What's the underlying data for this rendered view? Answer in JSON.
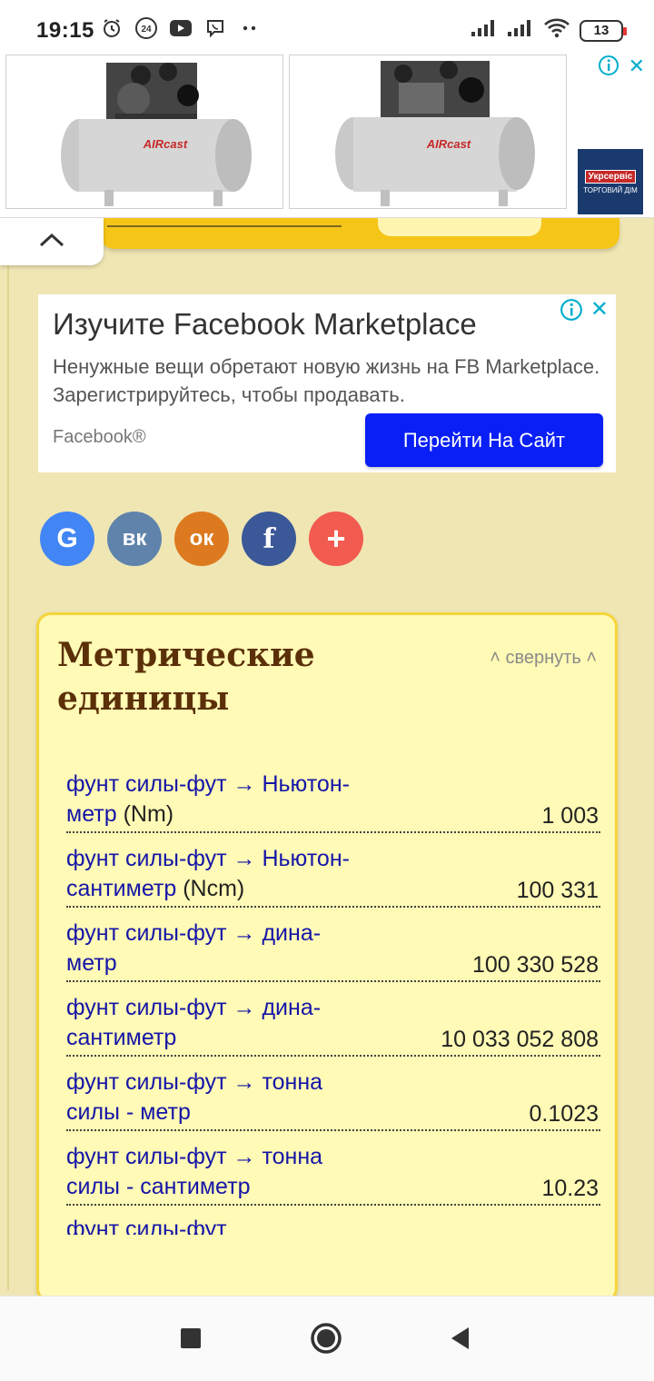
{
  "status_bar": {
    "time": "19:15",
    "notif_icons": [
      "alarm-icon",
      "clock-24-icon",
      "youtube-icon",
      "viber-icon",
      "more-dots-icon"
    ],
    "battery": "13"
  },
  "top_ad": {
    "product_brand": "AIRcast",
    "advertiser_name": "Укрсервіс",
    "advertiser_sub": "ТОРГОВИЙ ДІМ"
  },
  "fb_ad": {
    "title": "Изучите Facebook Marketplace",
    "description": "Ненужные вещи обретают новую жизнь на FB Marketplace. Зарегистрируйтесь, чтобы продавать.",
    "source": "Facebook®",
    "cta": "Перейти На Сайт"
  },
  "share": [
    {
      "name": "google",
      "glyph": "G",
      "color": "#4285f4"
    },
    {
      "name": "vk",
      "glyph": "вк",
      "color": "#5f83aa"
    },
    {
      "name": "odnoklassniki",
      "glyph": "ок",
      "color": "#dd7a1f"
    },
    {
      "name": "facebook",
      "glyph": "f",
      "color": "#3b5998"
    },
    {
      "name": "more",
      "glyph": "+",
      "color": "#f25b4f"
    }
  ],
  "units": {
    "title": "Метрические единицы",
    "collapse_label": "свернуть",
    "rows": [
      {
        "label": "фунт силы-фут → Ньютон-метр",
        "abbr": "(Nm)",
        "value": "1 003"
      },
      {
        "label": "фунт силы-фут → Ньютон-сантиметр",
        "abbr": "(Ncm)",
        "value": "100 331"
      },
      {
        "label": "фунт силы-фут → дина-метр",
        "abbr": "",
        "value": "100 330 528"
      },
      {
        "label": "фунт силы-фут → дина-сантиметр",
        "abbr": "",
        "value": "10 033 052 808"
      },
      {
        "label": "фунт силы-фут → тонна силы - метр",
        "abbr": "",
        "value": "0.1023"
      },
      {
        "label": "фунт силы-фут → тонна силы - сантиметр",
        "abbr": "",
        "value": "10.23"
      }
    ],
    "partial_row": "фунт силы-фут"
  },
  "colors": {
    "page_bg": "#efe6b4",
    "card_bg": "#fffab5",
    "link": "#1515a8",
    "title": "#5b3008",
    "fb_button": "#0a1ff5"
  }
}
